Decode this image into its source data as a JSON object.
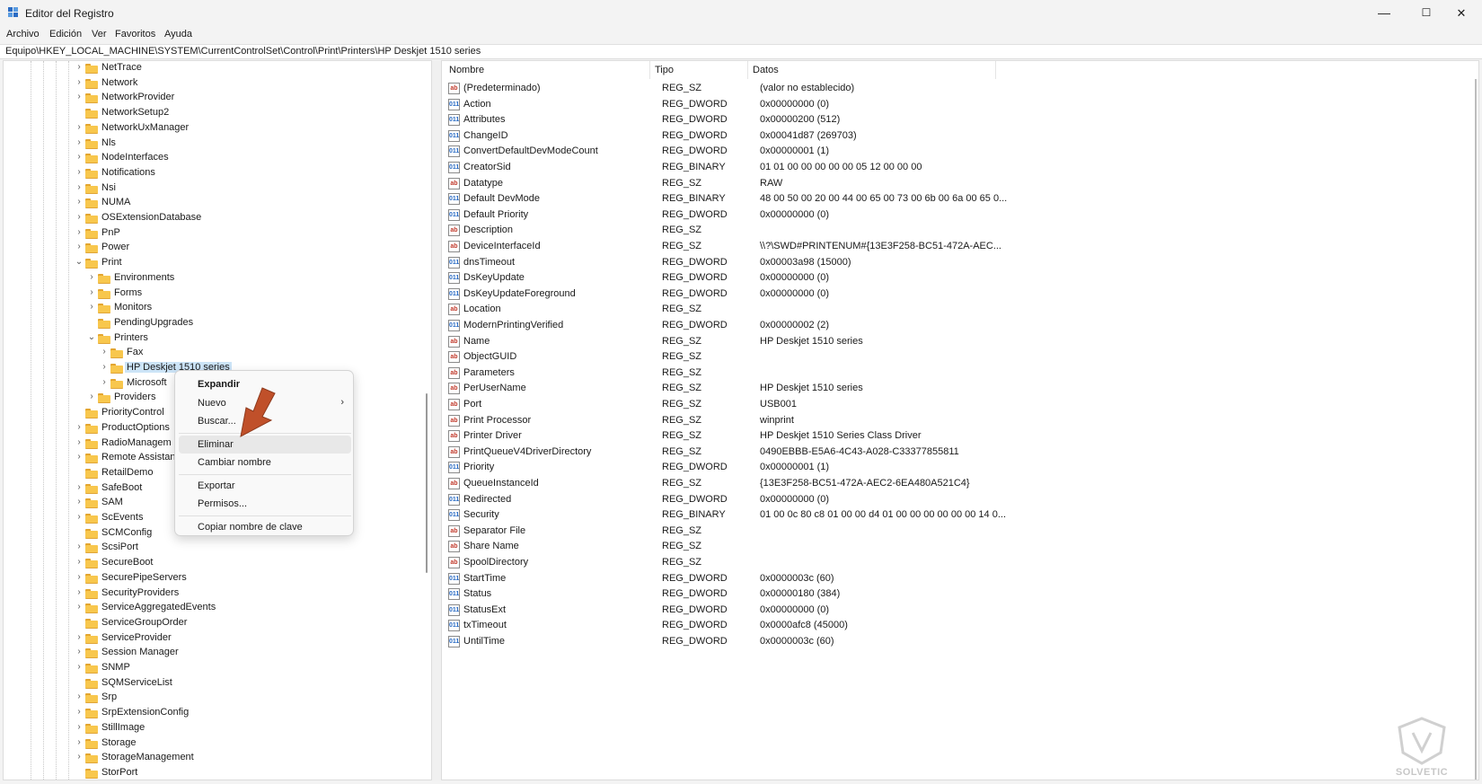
{
  "window": {
    "title": "Editor del Registro",
    "controls": {
      "minimize": "—",
      "maximize": "☐",
      "close": "✕"
    }
  },
  "menu": [
    "Archivo",
    "Edición",
    "Ver",
    "Favoritos",
    "Ayuda"
  ],
  "address": "Equipo\\HKEY_LOCAL_MACHINE\\SYSTEM\\CurrentControlSet\\Control\\Print\\Printers\\HP Deskjet 1510 series",
  "tree": [
    {
      "label": "NetTrace",
      "expander": "closed",
      "level": 0
    },
    {
      "label": "Network",
      "expander": "closed",
      "level": 0
    },
    {
      "label": "NetworkProvider",
      "expander": "closed",
      "level": 0
    },
    {
      "label": "NetworkSetup2",
      "expander": "none",
      "level": 0
    },
    {
      "label": "NetworkUxManager",
      "expander": "closed",
      "level": 0
    },
    {
      "label": "Nls",
      "expander": "closed",
      "level": 0
    },
    {
      "label": "NodeInterfaces",
      "expander": "closed",
      "level": 0
    },
    {
      "label": "Notifications",
      "expander": "closed",
      "level": 0
    },
    {
      "label": "Nsi",
      "expander": "closed",
      "level": 0
    },
    {
      "label": "NUMA",
      "expander": "closed",
      "level": 0
    },
    {
      "label": "OSExtensionDatabase",
      "expander": "closed",
      "level": 0
    },
    {
      "label": "PnP",
      "expander": "closed",
      "level": 0
    },
    {
      "label": "Power",
      "expander": "closed",
      "level": 0
    },
    {
      "label": "Print",
      "expander": "open",
      "level": 0
    },
    {
      "label": "Environments",
      "expander": "closed",
      "level": 1
    },
    {
      "label": "Forms",
      "expander": "closed",
      "level": 1
    },
    {
      "label": "Monitors",
      "expander": "closed",
      "level": 1
    },
    {
      "label": "PendingUpgrades",
      "expander": "none",
      "level": 1
    },
    {
      "label": "Printers",
      "expander": "open",
      "level": 1
    },
    {
      "label": "Fax",
      "expander": "closed",
      "level": 2
    },
    {
      "label": "HP Deskjet 1510 series",
      "expander": "closed",
      "level": 2,
      "selected": true
    },
    {
      "label": "Microsoft",
      "expander": "closed",
      "level": 2
    },
    {
      "label": "Providers",
      "expander": "closed",
      "level": 1
    },
    {
      "label": "PriorityControl",
      "expander": "none",
      "level": 0
    },
    {
      "label": "ProductOptions",
      "expander": "closed",
      "level": 0
    },
    {
      "label": "RadioManagem",
      "expander": "closed",
      "level": 0
    },
    {
      "label": "Remote Assistan",
      "expander": "closed",
      "level": 0
    },
    {
      "label": "RetailDemo",
      "expander": "none",
      "level": 0
    },
    {
      "label": "SafeBoot",
      "expander": "closed",
      "level": 0
    },
    {
      "label": "SAM",
      "expander": "closed",
      "level": 0
    },
    {
      "label": "ScEvents",
      "expander": "closed",
      "level": 0
    },
    {
      "label": "SCMConfig",
      "expander": "none",
      "level": 0
    },
    {
      "label": "ScsiPort",
      "expander": "closed",
      "level": 0
    },
    {
      "label": "SecureBoot",
      "expander": "closed",
      "level": 0
    },
    {
      "label": "SecurePipeServers",
      "expander": "closed",
      "level": 0
    },
    {
      "label": "SecurityProviders",
      "expander": "closed",
      "level": 0
    },
    {
      "label": "ServiceAggregatedEvents",
      "expander": "closed",
      "level": 0
    },
    {
      "label": "ServiceGroupOrder",
      "expander": "none",
      "level": 0
    },
    {
      "label": "ServiceProvider",
      "expander": "closed",
      "level": 0
    },
    {
      "label": "Session Manager",
      "expander": "closed",
      "level": 0
    },
    {
      "label": "SNMP",
      "expander": "closed",
      "level": 0
    },
    {
      "label": "SQMServiceList",
      "expander": "none",
      "level": 0
    },
    {
      "label": "Srp",
      "expander": "closed",
      "level": 0
    },
    {
      "label": "SrpExtensionConfig",
      "expander": "closed",
      "level": 0
    },
    {
      "label": "StillImage",
      "expander": "closed",
      "level": 0
    },
    {
      "label": "Storage",
      "expander": "closed",
      "level": 0
    },
    {
      "label": "StorageManagement",
      "expander": "closed",
      "level": 0
    },
    {
      "label": "StorPort",
      "expander": "none",
      "level": 0
    }
  ],
  "columns": [
    "Nombre",
    "Tipo",
    "Datos"
  ],
  "values": [
    {
      "icon": "sz",
      "name": "(Predeterminado)",
      "type": "REG_SZ",
      "data": "(valor no establecido)"
    },
    {
      "icon": "bin",
      "name": "Action",
      "type": "REG_DWORD",
      "data": "0x00000000 (0)"
    },
    {
      "icon": "bin",
      "name": "Attributes",
      "type": "REG_DWORD",
      "data": "0x00000200 (512)"
    },
    {
      "icon": "bin",
      "name": "ChangeID",
      "type": "REG_DWORD",
      "data": "0x00041d87 (269703)"
    },
    {
      "icon": "bin",
      "name": "ConvertDefaultDevModeCount",
      "type": "REG_DWORD",
      "data": "0x00000001 (1)"
    },
    {
      "icon": "bin",
      "name": "CreatorSid",
      "type": "REG_BINARY",
      "data": "01 01 00 00 00 00 00 05 12 00 00 00"
    },
    {
      "icon": "sz",
      "name": "Datatype",
      "type": "REG_SZ",
      "data": "RAW"
    },
    {
      "icon": "bin",
      "name": "Default DevMode",
      "type": "REG_BINARY",
      "data": "48 00 50 00 20 00 44 00 65 00 73 00 6b 00 6a 00 65 0..."
    },
    {
      "icon": "bin",
      "name": "Default Priority",
      "type": "REG_DWORD",
      "data": "0x00000000 (0)"
    },
    {
      "icon": "sz",
      "name": "Description",
      "type": "REG_SZ",
      "data": ""
    },
    {
      "icon": "sz",
      "name": "DeviceInterfaceId",
      "type": "REG_SZ",
      "data": "\\\\?\\SWD#PRINTENUM#{13E3F258-BC51-472A-AEC..."
    },
    {
      "icon": "bin",
      "name": "dnsTimeout",
      "type": "REG_DWORD",
      "data": "0x00003a98 (15000)"
    },
    {
      "icon": "bin",
      "name": "DsKeyUpdate",
      "type": "REG_DWORD",
      "data": "0x00000000 (0)"
    },
    {
      "icon": "bin",
      "name": "DsKeyUpdateForeground",
      "type": "REG_DWORD",
      "data": "0x00000000 (0)"
    },
    {
      "icon": "sz",
      "name": "Location",
      "type": "REG_SZ",
      "data": ""
    },
    {
      "icon": "bin",
      "name": "ModernPrintingVerified",
      "type": "REG_DWORD",
      "data": "0x00000002 (2)"
    },
    {
      "icon": "sz",
      "name": "Name",
      "type": "REG_SZ",
      "data": "HP Deskjet 1510 series"
    },
    {
      "icon": "sz",
      "name": "ObjectGUID",
      "type": "REG_SZ",
      "data": ""
    },
    {
      "icon": "sz",
      "name": "Parameters",
      "type": "REG_SZ",
      "data": ""
    },
    {
      "icon": "sz",
      "name": "PerUserName",
      "type": "REG_SZ",
      "data": "HP Deskjet 1510 series"
    },
    {
      "icon": "sz",
      "name": "Port",
      "type": "REG_SZ",
      "data": "USB001"
    },
    {
      "icon": "sz",
      "name": "Print Processor",
      "type": "REG_SZ",
      "data": "winprint"
    },
    {
      "icon": "sz",
      "name": "Printer Driver",
      "type": "REG_SZ",
      "data": "HP Deskjet 1510 Series Class Driver"
    },
    {
      "icon": "sz",
      "name": "PrintQueueV4DriverDirectory",
      "type": "REG_SZ",
      "data": "0490EBBB-E5A6-4C43-A028-C33377855811"
    },
    {
      "icon": "bin",
      "name": "Priority",
      "type": "REG_DWORD",
      "data": "0x00000001 (1)"
    },
    {
      "icon": "sz",
      "name": "QueueInstanceId",
      "type": "REG_SZ",
      "data": "{13E3F258-BC51-472A-AEC2-6EA480A521C4}"
    },
    {
      "icon": "bin",
      "name": "Redirected",
      "type": "REG_DWORD",
      "data": "0x00000000 (0)"
    },
    {
      "icon": "bin",
      "name": "Security",
      "type": "REG_BINARY",
      "data": "01 00 0c 80 c8 01 00 00 d4 01 00 00 00 00 00 00 14 0..."
    },
    {
      "icon": "sz",
      "name": "Separator File",
      "type": "REG_SZ",
      "data": ""
    },
    {
      "icon": "sz",
      "name": "Share Name",
      "type": "REG_SZ",
      "data": ""
    },
    {
      "icon": "sz",
      "name": "SpoolDirectory",
      "type": "REG_SZ",
      "data": ""
    },
    {
      "icon": "bin",
      "name": "StartTime",
      "type": "REG_DWORD",
      "data": "0x0000003c (60)"
    },
    {
      "icon": "bin",
      "name": "Status",
      "type": "REG_DWORD",
      "data": "0x00000180 (384)"
    },
    {
      "icon": "bin",
      "name": "StatusExt",
      "type": "REG_DWORD",
      "data": "0x00000000 (0)"
    },
    {
      "icon": "bin",
      "name": "txTimeout",
      "type": "REG_DWORD",
      "data": "0x0000afc8 (45000)"
    },
    {
      "icon": "bin",
      "name": "UntilTime",
      "type": "REG_DWORD",
      "data": "0x0000003c (60)"
    }
  ],
  "context_menu": {
    "items": [
      {
        "label": "Expandir",
        "bold": true
      },
      {
        "label": "Nuevo",
        "submenu": true
      },
      {
        "label": "Buscar..."
      },
      {
        "separator": true
      },
      {
        "label": "Eliminar",
        "hover": true
      },
      {
        "label": "Cambiar nombre"
      },
      {
        "separator": true
      },
      {
        "label": "Exportar"
      },
      {
        "label": "Permisos..."
      },
      {
        "separator": true
      },
      {
        "label": "Copiar nombre de clave"
      }
    ]
  },
  "icons": {
    "sz_glyph": "ab",
    "bin_glyph": "011",
    "expander_closed": "›",
    "expander_open": "⌄",
    "submenu_arrow": "›"
  },
  "colors": {
    "selection": "#cce4f7",
    "folder": "#f8c74d",
    "arrow": "#c0502a",
    "accent": "#2b6cc4"
  }
}
